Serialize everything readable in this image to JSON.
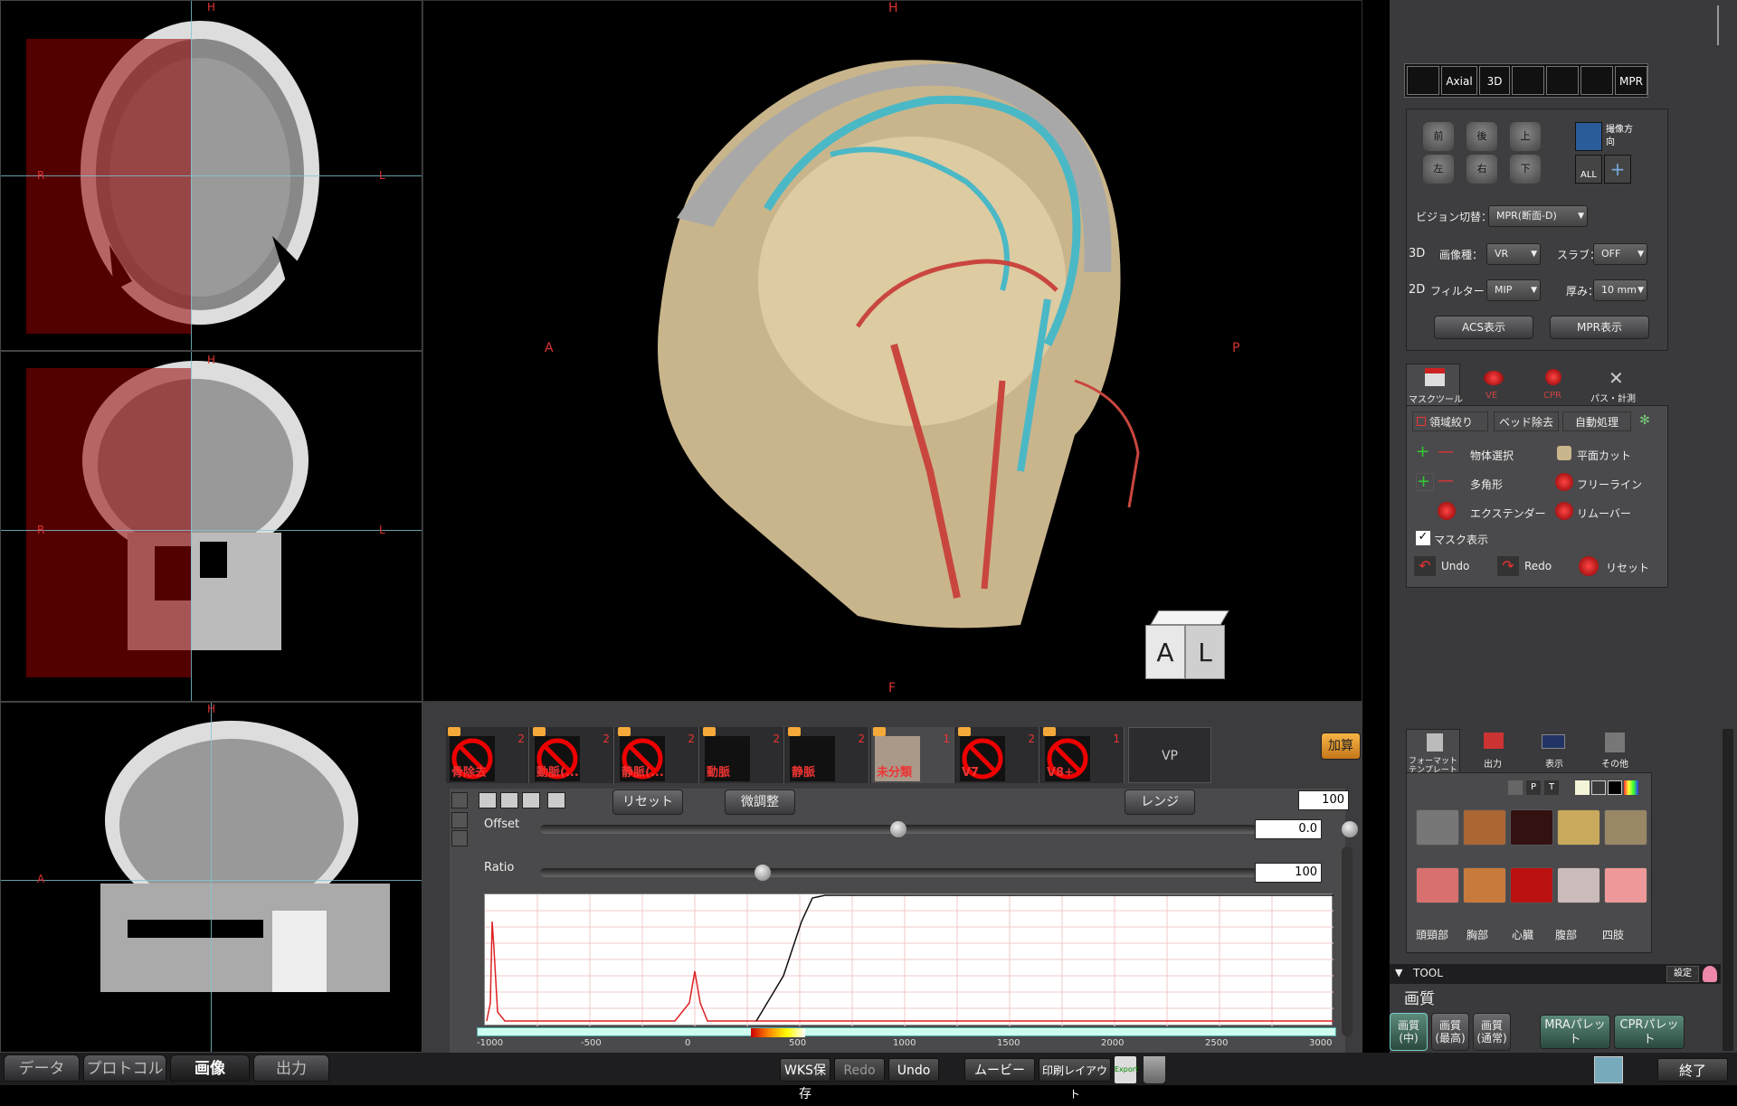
{
  "orientation": {
    "top": "H",
    "bottom": "F",
    "left": "A",
    "right": "P",
    "r": "R",
    "l": "L"
  },
  "cube": {
    "face_a": "A",
    "face_l": "L"
  },
  "tabs": [
    {
      "num": "2",
      "label": "骨除去"
    },
    {
      "num": "2",
      "label": "動脈(..."
    },
    {
      "num": "2",
      "label": "静脈(..."
    },
    {
      "num": "2",
      "label": "動脈"
    },
    {
      "num": "2",
      "label": "静脈"
    },
    {
      "num": "1",
      "label": "未分類"
    },
    {
      "num": "2",
      "label": "V7"
    },
    {
      "num": "1",
      "label": "V8+"
    }
  ],
  "vp_label": "VP",
  "add_button": "加算",
  "toolbar": {
    "reset": "リセット",
    "fine": "微調整",
    "range": "レンジ",
    "range_value": "100"
  },
  "offset": {
    "label": "Offset",
    "value": "0.0",
    "fraction": 0.5
  },
  "ratio": {
    "label": "Ratio",
    "value": "100",
    "fraction": 0.31
  },
  "axis_ticks": [
    "-1000",
    "-500",
    "0",
    "500",
    "1000",
    "1500",
    "2000",
    "2500",
    "3000"
  ],
  "right": {
    "layout_buttons": [
      "Axial",
      "3D",
      "MPR"
    ],
    "dir_buttons": [
      "前",
      "後",
      "上",
      "左",
      "右",
      "下"
    ],
    "camera_label": "撮像方向",
    "all_label": "ALL",
    "vision_label": "ビジョン切替：",
    "vision_value": "MPR(断面-D)",
    "row3d": {
      "prefix": "3D",
      "type_label": "画像種：",
      "type_value": "VR",
      "slab_label": "スラブ：",
      "slab_value": "OFF"
    },
    "row2d": {
      "prefix": "2D",
      "filter_label": "フィルター：",
      "filter_value": "MIP",
      "thick_label": "厚み：",
      "thick_value": "10 mm"
    },
    "acs_button": "ACS表示",
    "mpr_button": "MPR表示",
    "tool_tabs": [
      "マスクツール",
      "VE",
      "CPR",
      "パス・計測"
    ],
    "sub_tabs": [
      "領域絞り",
      "ベッド除去",
      "自動処理"
    ],
    "mask_tools": [
      "物体選択",
      "平面カット",
      "多角形",
      "フリーライン",
      "エクステンダー",
      "リムーバー"
    ],
    "mask_display": "マスク表示",
    "undo": "Undo",
    "redo": "Redo",
    "reset": "リセット",
    "tpl_tabs": [
      "フォーマットテンプレート",
      "出力",
      "表示",
      "その他"
    ],
    "pt_buttons": [
      "P",
      "T"
    ],
    "categories": [
      "頭頸部",
      "胸部",
      "心臓",
      "腹部",
      "四肢"
    ],
    "tool_header": "TOOL",
    "settings": "設定",
    "quality_title": "画質",
    "quality_buttons": [
      "画質(中)",
      "画質(最高)",
      "画質(通常)"
    ],
    "palette_buttons": [
      "MRAパレット",
      "CPRパレット"
    ]
  },
  "bottom": {
    "tabs": [
      "データ",
      "プロトコル",
      "画像",
      "出力"
    ],
    "wks": "WKS保存",
    "redo": "Redo",
    "undo": "Undo",
    "movie": "ムービー",
    "print": "印刷レイアウト",
    "export": "Export",
    "exit": "終了"
  }
}
